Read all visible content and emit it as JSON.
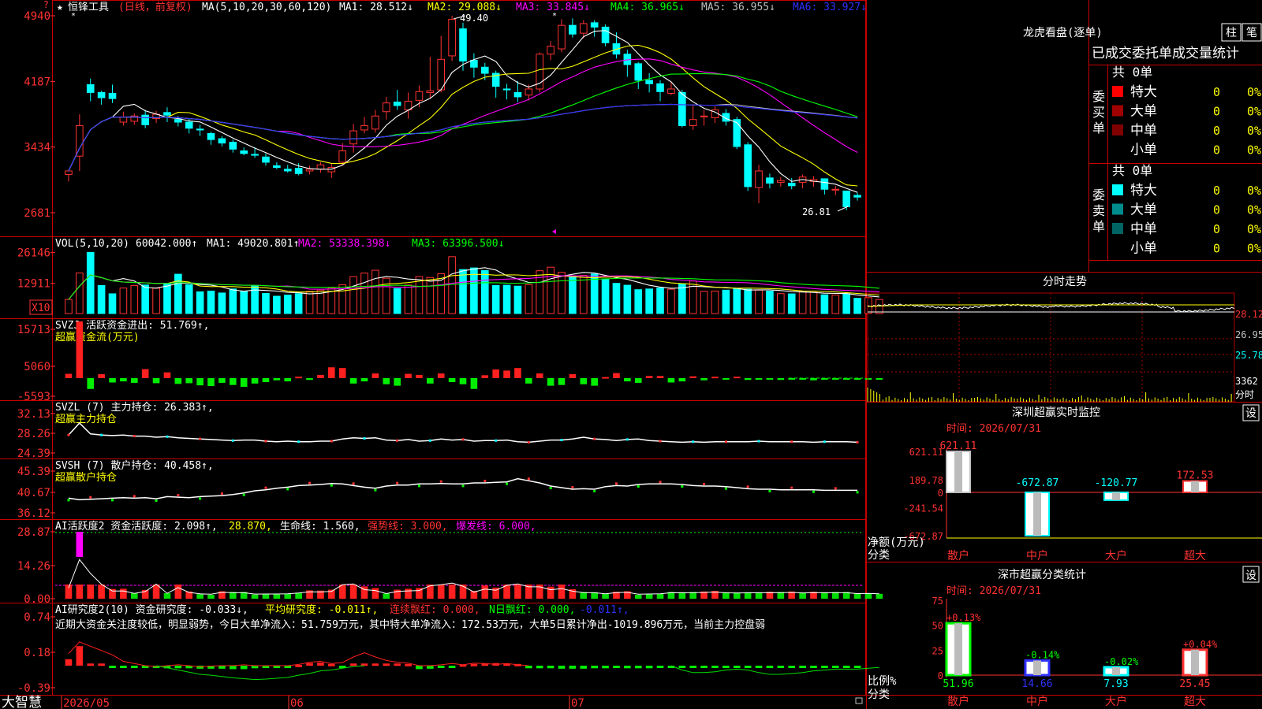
{
  "colors": {
    "up": "#ff3232",
    "down": "#00ffff",
    "ma1": "#ffffff",
    "ma2": "#ffff00",
    "ma3": "#ff00ff",
    "ma4": "#00ff00",
    "ma5": "#c0c0c0",
    "ma6": "#3030ff",
    "grid": "#b00000",
    "axis_text": "#ff3232"
  },
  "main": {
    "star_label": "★",
    "title": "恒锋工具",
    "period": "(日线，前复权)",
    "ma_prefix": "MA(5,10,20,30,60,120)",
    "ma_items": [
      {
        "label": "MA1: 28.512↓",
        "color": "#ffffff"
      },
      {
        "label": "MA2: 29.088↓",
        "color": "#ffff00"
      },
      {
        "label": "MA3: 33.845↓",
        "color": "#ff00ff"
      },
      {
        "label": "MA4: 36.965↓",
        "color": "#00ff00"
      },
      {
        "label": "MA5: 36.955↓",
        "color": "#c0c0c0"
      },
      {
        "label": "MA6: 33.927↓",
        "color": "#3030ff"
      }
    ],
    "yticks": [
      "49.40",
      "41.87",
      "34.34",
      "26.81"
    ],
    "yticks_display": [
      "4940",
      "4187",
      "3434",
      "2681"
    ],
    "high_label": "49.40",
    "low_label": "26.81",
    "ylim": [
      26.81,
      49.4
    ]
  },
  "dates": {
    "x_labels": [
      "2026/05",
      "06",
      "07"
    ]
  },
  "vol": {
    "label": "VOL(5,10,20)",
    "value": "60042.000↑",
    "ma1": "MA1: 49020.801↑",
    "ma2": "MA2: 53338.398↓",
    "ma3": "MA3: 63396.500↓",
    "yticks": [
      "26146",
      "12911"
    ],
    "unit": "X10"
  },
  "svzj": {
    "label": "SVZJ  活跃资金进出: 51.769↑,",
    "sub": "超赢资金流(万元)",
    "yticks": [
      "15713",
      "5060",
      "-5593"
    ]
  },
  "svzl": {
    "label": "SVZL (7) 主力持仓: 26.383↑,",
    "sub": "超赢主力持仓",
    "yticks": [
      "32.13",
      "28.26",
      "24.39"
    ]
  },
  "svsh": {
    "label": "SVSH (7) 散户持仓: 40.458↑,",
    "sub": "超赢散户持仓",
    "yticks": [
      "45.39",
      "40.67",
      "36.12"
    ]
  },
  "ai1": {
    "label": "AI活跃度2 资金活跃度: 2.098↑,",
    "v2": "28.870,",
    "v3": "生命线: 1.560,",
    "v4": "强势线: 3.000,",
    "v5": "爆发线: 6.000,",
    "yticks": [
      "28.87",
      "14.26",
      "0.00"
    ]
  },
  "ai2": {
    "label": "AI研究度2(10) 资金研究度: -0.033↓,",
    "v2": "平均研究度: -0.011↑,",
    "v3": "连续飘红: 0.000,",
    "v4": "N日飘红: 0.000,",
    "v5": "-0.011↑,",
    "comment": "近期大资金关注度较低，明显弱势，今日大单净流入：51.759万元，其中特大单净流入：172.53万元，大单5日累计净出-1019.896万元，当前主力控盘弱",
    "yticks": [
      "0.74",
      "0.18",
      "-0.39"
    ]
  },
  "bottom_left": "大智慧",
  "right": {
    "lhb_title": "龙虎看盘(逐单)",
    "btn_bar": "柱",
    "btn_pen": "笔",
    "tabs": "已成交委托单成交量统计",
    "buy_label": "委买单",
    "sell_label": "委卖单",
    "buy_total": "共 0单",
    "sell_total": "共 0单",
    "rows": [
      {
        "name": "特大",
        "count": "0",
        "pct": "0%"
      },
      {
        "name": "大单",
        "count": "0",
        "pct": "0%"
      },
      {
        "name": "中单",
        "count": "0",
        "pct": "0%"
      },
      {
        "name": "小单",
        "count": "0",
        "pct": "0%"
      }
    ],
    "intraday_title": "分时走势",
    "intraday_y": [
      "28.12",
      "26.95",
      "25.78",
      "3362"
    ],
    "intraday_unit": "分时",
    "sz_title": "深圳超赢实时监控",
    "sz_time": "时间: 2026/07/31",
    "sz_btn": "设",
    "sz_y": [
      "621.11",
      "189.78",
      "0",
      "-241.54",
      "-672.87"
    ],
    "sz_ylabel": "净额(万元)",
    "sz_xlabel": "分类",
    "sz_bars": [
      {
        "cat": "散户",
        "value": 621.11,
        "label": "621.11"
      },
      {
        "cat": "中户",
        "value": -672.87,
        "label": "-672.87"
      },
      {
        "cat": "大户",
        "value": -120.77,
        "label": "-120.77"
      },
      {
        "cat": "超大",
        "value": 172.53,
        "label": "172.53"
      }
    ],
    "cls_title": "深市超赢分类统计",
    "cls_time": "时间: 2026/07/31",
    "cls_btn": "设",
    "cls_y": [
      "75",
      "50",
      "25",
      "0"
    ],
    "cls_ylabel": "比例%",
    "cls_xlabel": "分类",
    "cls_bars": [
      {
        "cat": "散户",
        "value": 51.96,
        "label": "51.96",
        "delta": "+0.13%"
      },
      {
        "cat": "中户",
        "value": 14.66,
        "label": "14.66",
        "delta": "-0.14%"
      },
      {
        "cat": "大户",
        "value": 7.93,
        "label": "7.93",
        "delta": "-0.02%"
      },
      {
        "cat": "超大",
        "value": 25.45,
        "label": "25.45",
        "delta": "+0.04%"
      }
    ]
  },
  "chart_data": [
    {
      "type": "candlestick",
      "title": "恒锋工具 (日线，前复权)",
      "ylim": [
        26.81,
        49.4
      ],
      "ohlc": [
        [
          31.2,
          31.6,
          30.4,
          31.3
        ],
        [
          33.3,
          36.8,
          31.6,
          38.1
        ],
        [
          41.5,
          40.6,
          42.2,
          39.6
        ],
        [
          40.6,
          40.0,
          40.8,
          39.2
        ],
        [
          40.5,
          39.9,
          41.5,
          39.4
        ],
        [
          37.2,
          37.8,
          38.4,
          36.8
        ],
        [
          37.3,
          37.9,
          38.2,
          36.9
        ],
        [
          38.0,
          36.9,
          38.6,
          36.5
        ],
        [
          37.6,
          38.1,
          38.5,
          37.1
        ],
        [
          38.3,
          38.0,
          38.9,
          37.2
        ],
        [
          37.5,
          37.2,
          37.9,
          36.7
        ],
        [
          37.2,
          36.5,
          37.6,
          35.9
        ],
        [
          36.4,
          36.3,
          36.9,
          35.6
        ],
        [
          35.9,
          35.2,
          36.1,
          34.6
        ],
        [
          35.3,
          34.8,
          35.6,
          34.4
        ],
        [
          34.9,
          34.1,
          35.2,
          33.7
        ],
        [
          33.9,
          33.6,
          34.3,
          33.4
        ],
        [
          33.5,
          33.4,
          34.3,
          33.1
        ],
        [
          33.2,
          32.6,
          33.6,
          32.2
        ],
        [
          32.2,
          32.0,
          32.6,
          31.8
        ],
        [
          31.8,
          31.6,
          32.3,
          31.4
        ],
        [
          31.9,
          31.3,
          32.5,
          31.1
        ],
        [
          31.6,
          31.8,
          32.2,
          31.2
        ],
        [
          31.8,
          32.3,
          32.6,
          31.4
        ],
        [
          31.5,
          32.0,
          32.4,
          30.8
        ],
        [
          32.6,
          33.9,
          34.8,
          32.2
        ],
        [
          34.7,
          36.2,
          37.0,
          33.7
        ],
        [
          36.3,
          36.8,
          37.8,
          35.9
        ],
        [
          36.4,
          37.9,
          38.6,
          36.0
        ],
        [
          38.4,
          39.4,
          40.1,
          37.5
        ],
        [
          39.5,
          39.1,
          40.9,
          38.6
        ],
        [
          38.6,
          39.6,
          40.6,
          37.6
        ],
        [
          39.7,
          40.7,
          41.4,
          38.9
        ],
        [
          40.6,
          40.8,
          44.7,
          40.0
        ],
        [
          40.9,
          44.4,
          47.1,
          40.6
        ],
        [
          44.8,
          49.0,
          49.4,
          44.2
        ],
        [
          47.9,
          44.2,
          48.6,
          43.1
        ],
        [
          44.3,
          43.5,
          45.1,
          42.3
        ],
        [
          43.5,
          42.8,
          44.0,
          42.0
        ],
        [
          42.8,
          41.3,
          43.1,
          40.0
        ],
        [
          41.0,
          40.9,
          41.6,
          39.8
        ],
        [
          40.6,
          40.1,
          41.9,
          39.5
        ],
        [
          40.3,
          41.0,
          41.5,
          39.7
        ],
        [
          41.0,
          45.0,
          45.2,
          40.6
        ],
        [
          45.0,
          45.9,
          46.5,
          44.3
        ],
        [
          45.6,
          48.3,
          49.0,
          45.2
        ],
        [
          48.3,
          47.3,
          49.1,
          46.9
        ],
        [
          47.4,
          48.5,
          48.9,
          46.8
        ],
        [
          48.6,
          48.1,
          48.9,
          47.0
        ],
        [
          48.1,
          46.3,
          48.4,
          45.9
        ],
        [
          46.2,
          45.0,
          47.5,
          44.5
        ],
        [
          45.0,
          43.8,
          45.5,
          42.4
        ],
        [
          43.9,
          42.0,
          44.1,
          41.0
        ],
        [
          42.0,
          41.6,
          42.8,
          40.6
        ],
        [
          41.6,
          40.7,
          42.0,
          39.6
        ],
        [
          40.5,
          41.0,
          41.8,
          40.3
        ],
        [
          40.6,
          36.8,
          40.9,
          36.6
        ],
        [
          36.8,
          37.5,
          39.2,
          36.3
        ],
        [
          37.8,
          37.9,
          38.6,
          36.8
        ],
        [
          37.7,
          38.6,
          39.0,
          37.1
        ],
        [
          38.2,
          37.3,
          38.7,
          36.8
        ],
        [
          37.5,
          34.4,
          37.8,
          34.1
        ],
        [
          34.6,
          29.8,
          34.9,
          29.3
        ],
        [
          29.7,
          31.6,
          32.3,
          27.9
        ],
        [
          30.8,
          30.2,
          31.3,
          29.6
        ],
        [
          30.3,
          30.5,
          30.9,
          29.8
        ],
        [
          30.2,
          29.9,
          30.8,
          29.5
        ],
        [
          30.3,
          30.9,
          31.2,
          29.6
        ],
        [
          30.4,
          30.6,
          31.0,
          29.8
        ],
        [
          30.7,
          29.5,
          30.7,
          28.9
        ],
        [
          29.4,
          29.5,
          29.9,
          28.8
        ],
        [
          29.3,
          27.5,
          29.3,
          27.1
        ],
        [
          28.8,
          28.6,
          29.1,
          28.2
        ]
      ],
      "ma": {
        "MA1": 28.512,
        "MA2": 29.088,
        "MA3": 33.845,
        "MA4": 36.965,
        "MA5": 36.955,
        "MA6": 33.927
      }
    },
    {
      "type": "bar",
      "title": "VOL(5,10,20)",
      "values": [
        6010,
        17330,
        26146,
        12000,
        8440,
        10900,
        12000,
        12200,
        10800,
        12800,
        16800,
        12300,
        9300,
        9600,
        8780,
        10500,
        9430,
        12000,
        8600,
        7400,
        7900,
        8500,
        9500,
        10000,
        11000,
        12300,
        15800,
        17300,
        18500,
        15100,
        10700,
        12200,
        15800,
        15400,
        17000,
        24300,
        18800,
        19500,
        18400,
        12000,
        12100,
        11700,
        12300,
        18300,
        19800,
        17600,
        15900,
        16300,
        16900,
        14800,
        12900,
        12100,
        10200,
        10500,
        10900,
        10400,
        12700,
        13900,
        9500,
        9600,
        10000,
        10700,
        10400,
        10000,
        9600,
        8500,
        8400,
        9500,
        9100,
        8000,
        7900,
        8300,
        6500,
        6800,
        6000
      ]
    },
    {
      "type": "bar",
      "title": "超赢资金流(万元)",
      "values": [
        1200,
        15713,
        -3000,
        1100,
        -1200,
        -900,
        -1300,
        2500,
        -1400,
        1600,
        -1600,
        -1400,
        -2000,
        -2200,
        -1300,
        -1900,
        -2400,
        -1500,
        -1100,
        -600,
        -900,
        400,
        -500,
        900,
        3000,
        2800,
        -1500,
        -900,
        1300,
        -1700,
        -2100,
        1200,
        900,
        -1500,
        1300,
        -1100,
        -1700,
        -3000,
        800,
        2400,
        2100,
        2800,
        -1500,
        1300,
        -2100,
        -1900,
        1100,
        -1700,
        -2100,
        300,
        1400,
        -900,
        -1300,
        600,
        600,
        -1200,
        -900,
        500,
        -600,
        400,
        -300,
        400,
        -500,
        -200,
        -400,
        -500,
        -300,
        -400,
        -600,
        -300,
        -400,
        -300,
        -200,
        -300,
        -200
      ]
    },
    {
      "type": "line",
      "title": "超赢主力持仓",
      "ylim": [
        24.39,
        32.13
      ]
    },
    {
      "type": "line",
      "title": "超赢散户持仓",
      "ylim": [
        36.12,
        45.39
      ]
    },
    {
      "type": "bar",
      "title": "AI活跃度2",
      "values": [
        6.5,
        28.87,
        18.0,
        9.5,
        4.2,
        4.3,
        2.4,
        3.8,
        9.6,
        2.4,
        6.9,
        3.1,
        2.0,
        1.7,
        3.2,
        2.9,
        2.9,
        1.8,
        1.9,
        1.9,
        2.1,
        2.6,
        3.6,
        3.5,
        3.9,
        9.1,
        9.8,
        5.3,
        4.6,
        2.2,
        3.9,
        4.3,
        4.6,
        8.3,
        9.1,
        10.5,
        8.0,
        3.4,
        5.7,
        4.8,
        8.7,
        9.8,
        7.5,
        7.5,
        5.2,
        6.1,
        4.1,
        2.9,
        2.8,
        2.1,
        3.0,
        3.2,
        1.7,
        1.9,
        2.1,
        2.9,
        2.8,
        2.9,
        3.1,
        3.4,
        2.8,
        2.7,
        2.8,
        2.8,
        3.0,
        2.9,
        3.1,
        2.7,
        3.0,
        2.8,
        2.9,
        2.9,
        2.2,
        2.3,
        2.1
      ]
    },
    {
      "type": "bar",
      "title": "AI研究度2(10)",
      "ylim": [
        -0.39,
        0.74
      ]
    },
    {
      "type": "bar",
      "title": "深圳超赢实时监控",
      "categories": [
        "散户",
        "中户",
        "大户",
        "超大"
      ],
      "values": [
        621.11,
        -672.87,
        -120.77,
        172.53
      ],
      "ylabel": "净额(万元)",
      "xlabel": "分类"
    },
    {
      "type": "bar",
      "title": "深市超赢分类统计",
      "categories": [
        "散户",
        "中户",
        "大户",
        "超大"
      ],
      "values": [
        51.96,
        14.66,
        7.93,
        25.45
      ],
      "ylabel": "比例%",
      "xlabel": "分类"
    }
  ]
}
